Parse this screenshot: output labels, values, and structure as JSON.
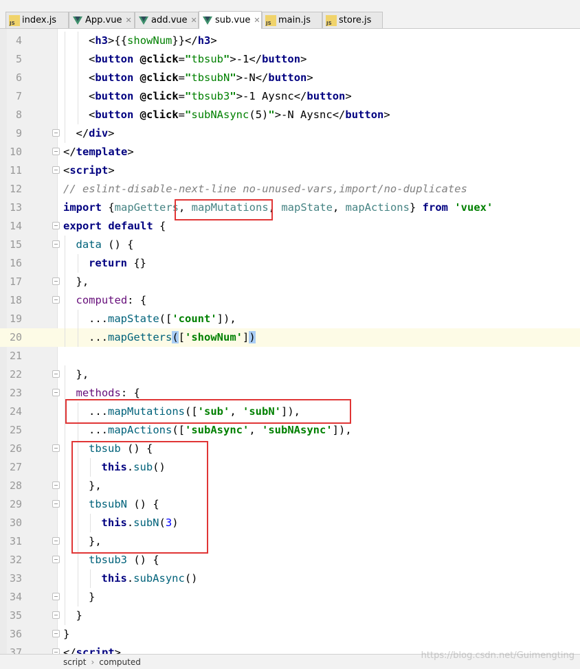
{
  "tabs": [
    {
      "label": "index.js",
      "icon": "js-file-icon",
      "active": false,
      "closable": false
    },
    {
      "label": "App.vue",
      "icon": "vue-file-icon",
      "active": false,
      "closable": true
    },
    {
      "label": "add.vue",
      "icon": "vue-file-icon",
      "active": false,
      "closable": true
    },
    {
      "label": "sub.vue",
      "icon": "vue-file-icon",
      "active": true,
      "closable": true
    },
    {
      "label": "main.js",
      "icon": "js-file-icon",
      "active": false,
      "closable": false
    },
    {
      "label": "store.js",
      "icon": "js-file-icon",
      "active": false,
      "closable": false
    }
  ],
  "close_glyph": "✕",
  "highlighted_line": 20,
  "lines": [
    {
      "n": 4,
      "indent": 2,
      "tokens": [
        [
          "tagbr",
          "<"
        ],
        [
          "tag",
          "h3"
        ],
        [
          "tagbr",
          ">"
        ],
        [
          "plain",
          "{{"
        ],
        [
          "attrval",
          "showNum"
        ],
        [
          "plain",
          "}}"
        ],
        [
          "tagbr",
          "</"
        ],
        [
          "tag",
          "h3"
        ],
        [
          "tagbr",
          ">"
        ]
      ]
    },
    {
      "n": 5,
      "indent": 2,
      "tokens": [
        [
          "tagbr",
          "<"
        ],
        [
          "tag",
          "button "
        ],
        [
          "attr",
          "@click"
        ],
        [
          "plain",
          "="
        ],
        [
          "str",
          "\""
        ],
        [
          "attrval",
          "tbsub"
        ],
        [
          "str",
          "\""
        ],
        [
          "tagbr",
          ">"
        ],
        [
          "plain",
          "-1"
        ],
        [
          "tagbr",
          "</"
        ],
        [
          "tag",
          "button"
        ],
        [
          "tagbr",
          ">"
        ]
      ]
    },
    {
      "n": 6,
      "indent": 2,
      "tokens": [
        [
          "tagbr",
          "<"
        ],
        [
          "tag",
          "button "
        ],
        [
          "attr",
          "@click"
        ],
        [
          "plain",
          "="
        ],
        [
          "str",
          "\""
        ],
        [
          "attrval",
          "tbsubN"
        ],
        [
          "str",
          "\""
        ],
        [
          "tagbr",
          ">"
        ],
        [
          "plain",
          "-N"
        ],
        [
          "tagbr",
          "</"
        ],
        [
          "tag",
          "button"
        ],
        [
          "tagbr",
          ">"
        ]
      ]
    },
    {
      "n": 7,
      "indent": 2,
      "tokens": [
        [
          "tagbr",
          "<"
        ],
        [
          "tag",
          "button "
        ],
        [
          "attr",
          "@click"
        ],
        [
          "plain",
          "="
        ],
        [
          "str",
          "\""
        ],
        [
          "attrval",
          "tbsub3"
        ],
        [
          "str",
          "\""
        ],
        [
          "tagbr",
          ">"
        ],
        [
          "plain",
          "-1 Aysnc"
        ],
        [
          "tagbr",
          "</"
        ],
        [
          "tag",
          "button"
        ],
        [
          "tagbr",
          ">"
        ]
      ]
    },
    {
      "n": 8,
      "indent": 2,
      "tokens": [
        [
          "tagbr",
          "<"
        ],
        [
          "tag",
          "button "
        ],
        [
          "attr",
          "@click"
        ],
        [
          "plain",
          "="
        ],
        [
          "str",
          "\""
        ],
        [
          "attrval",
          "subNAsync"
        ],
        [
          "plain",
          "(5)"
        ],
        [
          "str",
          "\""
        ],
        [
          "tagbr",
          ">"
        ],
        [
          "plain",
          "-N Aysnc"
        ],
        [
          "tagbr",
          "</"
        ],
        [
          "tag",
          "button"
        ],
        [
          "tagbr",
          ">"
        ]
      ]
    },
    {
      "n": 9,
      "indent": 1,
      "fold": true,
      "tokens": [
        [
          "tagbr",
          "</"
        ],
        [
          "tag",
          "div"
        ],
        [
          "tagbr",
          ">"
        ]
      ]
    },
    {
      "n": 10,
      "indent": 0,
      "fold": true,
      "tokens": [
        [
          "tagbr",
          "</"
        ],
        [
          "tag",
          "template"
        ],
        [
          "tagbr",
          ">"
        ]
      ]
    },
    {
      "n": 11,
      "indent": 0,
      "fold": true,
      "tokens": [
        [
          "tagbr",
          "<"
        ],
        [
          "tag",
          "script"
        ],
        [
          "tagbr",
          ">"
        ]
      ]
    },
    {
      "n": 12,
      "indent": 0,
      "tokens": [
        [
          "cmt",
          "// eslint-disable-next-line no-unused-vars,import/no-duplicates"
        ]
      ]
    },
    {
      "n": 13,
      "indent": 0,
      "tokens": [
        [
          "kw",
          "import "
        ],
        [
          "plain",
          "{"
        ],
        [
          "idf",
          "mapGetters"
        ],
        [
          "plain",
          ", "
        ],
        [
          "idf",
          "mapMutations"
        ],
        [
          "plain",
          ", "
        ],
        [
          "idf",
          "mapState"
        ],
        [
          "plain",
          ", "
        ],
        [
          "idf",
          "mapActions"
        ],
        [
          "plain",
          "} "
        ],
        [
          "kw",
          "from "
        ],
        [
          "str",
          "'vuex'"
        ]
      ]
    },
    {
      "n": 14,
      "indent": 0,
      "fold": true,
      "tokens": [
        [
          "kw",
          "export default "
        ],
        [
          "plain",
          "{"
        ]
      ]
    },
    {
      "n": 15,
      "indent": 1,
      "fold": true,
      "tokens": [
        [
          "fn",
          "data "
        ],
        [
          "plain",
          "() {"
        ]
      ]
    },
    {
      "n": 16,
      "indent": 2,
      "tokens": [
        [
          "kw",
          "return "
        ],
        [
          "plain",
          "{}"
        ]
      ]
    },
    {
      "n": 17,
      "indent": 1,
      "fold": true,
      "tokens": [
        [
          "plain",
          "},"
        ]
      ]
    },
    {
      "n": 18,
      "indent": 1,
      "fold": true,
      "tokens": [
        [
          "prop",
          "computed"
        ],
        [
          "plain",
          ": {"
        ]
      ]
    },
    {
      "n": 19,
      "indent": 2,
      "tokens": [
        [
          "plain",
          "..."
        ],
        [
          "fn",
          "mapState"
        ],
        [
          "plain",
          "(["
        ],
        [
          "str",
          "'count'"
        ],
        [
          "plain",
          "]),"
        ]
      ]
    },
    {
      "n": 20,
      "indent": 2,
      "tokens": [
        [
          "plain",
          "..."
        ],
        [
          "fn",
          "mapGetters"
        ],
        [
          "brmatch",
          "("
        ],
        [
          "plain",
          "["
        ],
        [
          "str",
          "'showNum'"
        ],
        [
          "plain",
          "]"
        ],
        [
          "brmatch",
          ")"
        ]
      ]
    },
    {
      "n": 21,
      "indent": 0,
      "tokens": []
    },
    {
      "n": 22,
      "indent": 1,
      "fold": true,
      "tokens": [
        [
          "plain",
          "},"
        ]
      ]
    },
    {
      "n": 23,
      "indent": 1,
      "fold": true,
      "tokens": [
        [
          "prop",
          "methods"
        ],
        [
          "plain",
          ": {"
        ]
      ]
    },
    {
      "n": 24,
      "indent": 2,
      "tokens": [
        [
          "plain",
          "..."
        ],
        [
          "fn",
          "mapMutations"
        ],
        [
          "plain",
          "(["
        ],
        [
          "str",
          "'sub'"
        ],
        [
          "plain",
          ", "
        ],
        [
          "str",
          "'subN'"
        ],
        [
          "plain",
          "]),"
        ]
      ]
    },
    {
      "n": 25,
      "indent": 2,
      "tokens": [
        [
          "plain",
          "..."
        ],
        [
          "fn",
          "mapActions"
        ],
        [
          "plain",
          "(["
        ],
        [
          "str",
          "'subAsync'"
        ],
        [
          "plain",
          ", "
        ],
        [
          "str",
          "'subNAsync'"
        ],
        [
          "plain",
          "]),"
        ]
      ]
    },
    {
      "n": 26,
      "indent": 2,
      "fold": true,
      "tokens": [
        [
          "fn",
          "tbsub "
        ],
        [
          "plain",
          "() {"
        ]
      ]
    },
    {
      "n": 27,
      "indent": 3,
      "tokens": [
        [
          "kw",
          "this"
        ],
        [
          "plain",
          "."
        ],
        [
          "fn",
          "sub"
        ],
        [
          "plain",
          "()"
        ]
      ]
    },
    {
      "n": 28,
      "indent": 2,
      "fold": true,
      "tokens": [
        [
          "plain",
          "},"
        ]
      ]
    },
    {
      "n": 29,
      "indent": 2,
      "fold": true,
      "tokens": [
        [
          "fn",
          "tbsubN "
        ],
        [
          "plain",
          "() {"
        ]
      ]
    },
    {
      "n": 30,
      "indent": 3,
      "tokens": [
        [
          "kw",
          "this"
        ],
        [
          "plain",
          "."
        ],
        [
          "fn",
          "subN"
        ],
        [
          "plain",
          "("
        ],
        [
          "num",
          "3"
        ],
        [
          "plain",
          ")"
        ]
      ]
    },
    {
      "n": 31,
      "indent": 2,
      "fold": true,
      "tokens": [
        [
          "plain",
          "},"
        ]
      ]
    },
    {
      "n": 32,
      "indent": 2,
      "fold": true,
      "tokens": [
        [
          "fn",
          "tbsub3 "
        ],
        [
          "plain",
          "() {"
        ]
      ]
    },
    {
      "n": 33,
      "indent": 3,
      "tokens": [
        [
          "kw",
          "this"
        ],
        [
          "plain",
          "."
        ],
        [
          "fn",
          "subAsync"
        ],
        [
          "plain",
          "()"
        ]
      ]
    },
    {
      "n": 34,
      "indent": 2,
      "fold": true,
      "tokens": [
        [
          "plain",
          "}"
        ]
      ]
    },
    {
      "n": 35,
      "indent": 1,
      "fold": true,
      "tokens": [
        [
          "plain",
          "}"
        ]
      ]
    },
    {
      "n": 36,
      "indent": 0,
      "fold": true,
      "tokens": [
        [
          "plain",
          "}"
        ]
      ]
    },
    {
      "n": 37,
      "indent": 0,
      "fold": true,
      "tokens": [
        [
          "tagbr",
          "</"
        ],
        [
          "tag",
          "script"
        ],
        [
          "tagbr",
          ">"
        ]
      ]
    }
  ],
  "annotations": [
    {
      "label": "mapMutations import"
    },
    {
      "label": "mapMutations spread"
    },
    {
      "label": "tbsub / tbsubN methods"
    }
  ],
  "status": {
    "crumb1": "script",
    "sep": "›",
    "crumb2": "computed"
  },
  "watermark": "https://blog.csdn.net/Guimengting"
}
